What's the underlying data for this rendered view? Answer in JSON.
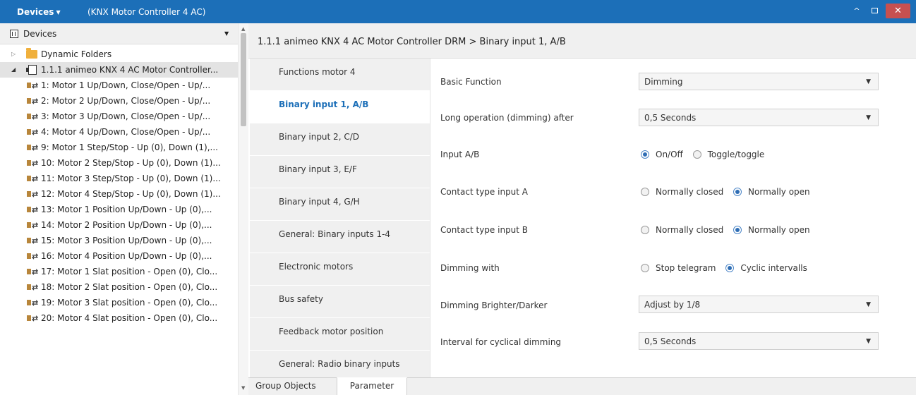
{
  "titlebar": {
    "menu_label": "Devices",
    "window_title": "(KNX Motor Controller 4 AC)"
  },
  "left_panel": {
    "header_label": "Devices",
    "tree": [
      {
        "label": "Dynamic Folders",
        "type": "folder"
      },
      {
        "label": "1.1.1 animeo KNX 4 AC Motor Controller...",
        "type": "device"
      },
      {
        "label": "1: Motor 1 Up/Down, Close/Open - Up/...",
        "type": "object"
      },
      {
        "label": "2: Motor 2 Up/Down, Close/Open - Up/...",
        "type": "object"
      },
      {
        "label": "3: Motor 3 Up/Down, Close/Open - Up/...",
        "type": "object"
      },
      {
        "label": "4: Motor 4 Up/Down, Close/Open - Up/...",
        "type": "object"
      },
      {
        "label": "9: Motor 1 Step/Stop - Up (0), Down (1),...",
        "type": "object"
      },
      {
        "label": "10: Motor 2 Step/Stop - Up (0), Down (1)...",
        "type": "object"
      },
      {
        "label": "11: Motor 3 Step/Stop - Up (0), Down (1)...",
        "type": "object"
      },
      {
        "label": "12: Motor 4 Step/Stop - Up (0), Down (1)...",
        "type": "object"
      },
      {
        "label": "13: Motor 1 Position Up/Down - Up (0),...",
        "type": "object"
      },
      {
        "label": "14: Motor 2 Position Up/Down - Up (0),...",
        "type": "object"
      },
      {
        "label": "15: Motor 3 Position Up/Down - Up (0),...",
        "type": "object"
      },
      {
        "label": "16: Motor 4 Position Up/Down - Up (0),...",
        "type": "object"
      },
      {
        "label": "17: Motor 1 Slat position - Open (0), Clo...",
        "type": "object"
      },
      {
        "label": "18: Motor 2 Slat position - Open (0), Clo...",
        "type": "object"
      },
      {
        "label": "19: Motor 3 Slat position - Open (0), Clo...",
        "type": "object"
      },
      {
        "label": "20: Motor 4 Slat position - Open (0), Clo...",
        "type": "object"
      }
    ]
  },
  "main": {
    "title": "1.1.1 animeo KNX 4 AC Motor Controller DRM > Binary input 1, A/B",
    "nav": [
      "Functions motor 4",
      "Binary input 1, A/B",
      "Binary input 2, C/D",
      "Binary input 3, E/F",
      "Binary input 4, G/H",
      "General: Binary inputs 1-4",
      "Electronic motors",
      "Bus safety",
      "Feedback motor position",
      "General: Radio binary inputs"
    ],
    "active_nav": "Binary input 1, A/B",
    "params": {
      "basic_function": {
        "label": "Basic Function",
        "value": "Dimming"
      },
      "long_operation": {
        "label": "Long operation (dimming) after",
        "value": "0,5 Seconds"
      },
      "input_ab": {
        "label": "Input A/B",
        "options": [
          "On/Off",
          "Toggle/toggle"
        ],
        "selected": "On/Off"
      },
      "contact_a": {
        "label": "Contact type input A",
        "options": [
          "Normally closed",
          "Normally open"
        ],
        "selected": "Normally open"
      },
      "contact_b": {
        "label": "Contact type input B",
        "options": [
          "Normally closed",
          "Normally open"
        ],
        "selected": "Normally open"
      },
      "dimming_with": {
        "label": "Dimming with",
        "options": [
          "Stop telegram",
          "Cyclic intervalls"
        ],
        "selected": "Cyclic intervalls"
      },
      "brighter_darker": {
        "label": "Dimming Brighter/Darker",
        "value": "Adjust by 1/8"
      },
      "interval": {
        "label": "Interval for cyclical dimming",
        "value": "0,5 Seconds"
      }
    },
    "bottom_tabs": [
      "Group Objects",
      "Parameter"
    ],
    "active_bottom_tab": "Parameter"
  },
  "colors": {
    "titlebar_bg": "#1c6fb8",
    "accent": "#1c6fb8",
    "close_button": "#c75050"
  }
}
